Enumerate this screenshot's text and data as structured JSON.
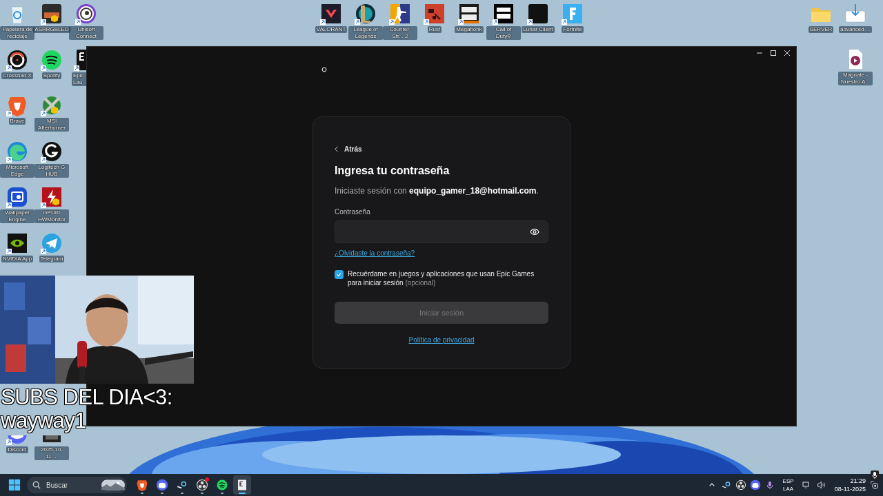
{
  "desktop": {
    "icons_left": [
      {
        "kind": "recycle",
        "label": "Papelera de reciclaje"
      },
      {
        "kind": "crosshair",
        "label": "Crosshair X"
      },
      {
        "kind": "brave",
        "label": "Brave"
      },
      {
        "kind": "edge",
        "label": "Microsoft Edge"
      },
      {
        "kind": "wallpaper",
        "label": "Wallpaper Engine"
      },
      {
        "kind": "nvidia",
        "label": "NVIDIA App"
      },
      {
        "kind": "asrock",
        "label": "ASRRGBLED"
      },
      {
        "kind": "spotify",
        "label": "Spotify"
      },
      {
        "kind": "msi",
        "label": "MSI Afterburner"
      },
      {
        "kind": "logitech",
        "label": "Logitech G HUB"
      },
      {
        "kind": "gpuid",
        "label": "GPUID HWMonitor"
      },
      {
        "kind": "telegram",
        "label": "Telegram"
      },
      {
        "kind": "ubisoft",
        "label": "Ubisoft Connect"
      },
      {
        "kind": "epic",
        "label": "Epic Lau",
        "clipped": true
      }
    ],
    "icons_bottom": [
      {
        "kind": "discord",
        "label": "Discord"
      },
      {
        "kind": "video",
        "label": "2025-10-11-..."
      }
    ],
    "icons_top": [
      {
        "kind": "valorant",
        "label": "VALORANT"
      },
      {
        "kind": "lol",
        "label": "League of Legends"
      },
      {
        "kind": "cs",
        "label": "Counter-Str... 2"
      },
      {
        "kind": "rust",
        "label": "Rust"
      },
      {
        "kind": "megabonk",
        "label": "Megabonk"
      },
      {
        "kind": "cod",
        "label": "Call of Duty®"
      },
      {
        "kind": "lunar",
        "label": "Lunar Client"
      },
      {
        "kind": "fortnite",
        "label": "Fortnite"
      }
    ],
    "icons_right": [
      {
        "kind": "folder",
        "label": "SERVER"
      },
      {
        "kind": "download",
        "label": "advanced-..."
      },
      {
        "kind": "media",
        "label": "Magnate - Nuestro A..."
      }
    ]
  },
  "login": {
    "back": "Atrás",
    "title": "Ingresa tu contraseña",
    "subtitle": "Iniciaste sesión con **equipo_gamer_18@hotmail.com**.",
    "password": {
      "label": "Contraseña"
    },
    "forgot_link": "¿Olvidaste la contraseña?",
    "remember": {
      "text": "Recuérdame en juegos y aplicaciones que usan Epic Games para iniciar sesión",
      "optional": "(opcional)",
      "checked": true
    },
    "submit": {
      "label": "Iniciar sesión",
      "disabled": true
    },
    "privacy_link": "Política de privacidad"
  },
  "webcam": {
    "kind": "picture"
  },
  "overlay_text": [
    "SUBS DEL DIA<3:",
    "wayway1"
  ],
  "taskbar": {
    "search": {
      "placeholder": "Buscar"
    },
    "pinned": [
      {
        "kind": "brave",
        "running": true,
        "selected": false,
        "notification": false
      },
      {
        "kind": "discord",
        "running": true,
        "selected": false,
        "notification": false
      },
      {
        "kind": "steam",
        "running": true,
        "selected": false,
        "notification": false
      },
      {
        "kind": "obs",
        "running": true,
        "selected": false,
        "notification": true
      },
      {
        "kind": "spotify",
        "running": true,
        "selected": false,
        "notification": false
      },
      {
        "kind": "epic",
        "running": true,
        "selected": true,
        "notification": false
      }
    ],
    "tray": [
      {
        "kind": "chevron"
      },
      {
        "kind": "steam"
      },
      {
        "kind": "obs"
      },
      {
        "kind": "discord"
      },
      {
        "kind": "mic"
      }
    ],
    "language": [
      "ESP",
      "LAA"
    ],
    "time": "21:29",
    "date": "08-11-2025"
  }
}
